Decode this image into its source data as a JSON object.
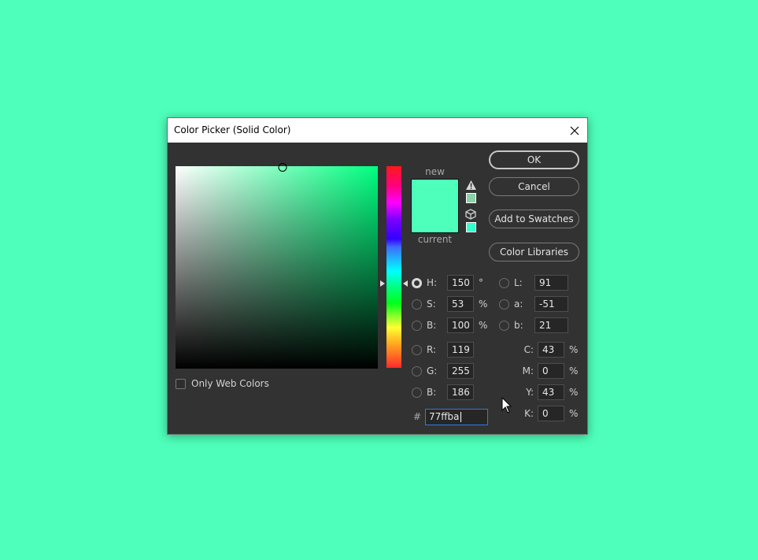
{
  "window": {
    "title": "Color Picker (Solid Color)",
    "close_icon": "close-icon"
  },
  "color": {
    "hue_base": "#00ff80",
    "new": "#4dffba",
    "current": "#4dffba",
    "out_of_gamut_swatch": "#8ad0a8",
    "web_safe_swatch": "#33ffcc"
  },
  "labels": {
    "new": "new",
    "current": "current",
    "only_web_colors": "Only Web Colors",
    "hex_prefix": "#"
  },
  "buttons": {
    "ok": "OK",
    "cancel": "Cancel",
    "add_to_swatches": "Add to Swatches",
    "color_libraries": "Color Libraries"
  },
  "hsb": [
    {
      "label": "H:",
      "value": "150",
      "unit": "°",
      "selected": true
    },
    {
      "label": "S:",
      "value": "53",
      "unit": "%",
      "selected": false
    },
    {
      "label": "B:",
      "value": "100",
      "unit": "%",
      "selected": false
    }
  ],
  "lab": [
    {
      "label": "L:",
      "value": "91"
    },
    {
      "label": "a:",
      "value": "-51"
    },
    {
      "label": "b:",
      "value": "21"
    }
  ],
  "rgb": [
    {
      "label": "R:",
      "value": "119"
    },
    {
      "label": "G:",
      "value": "255"
    },
    {
      "label": "B:",
      "value": "186"
    }
  ],
  "cmyk": [
    {
      "label": "C:",
      "value": "43",
      "unit": "%"
    },
    {
      "label": "M:",
      "value": "0",
      "unit": "%"
    },
    {
      "label": "Y:",
      "value": "43",
      "unit": "%"
    },
    {
      "label": "K:",
      "value": "0",
      "unit": "%"
    }
  ],
  "hex": "77ffba",
  "only_web_colors_checked": false
}
